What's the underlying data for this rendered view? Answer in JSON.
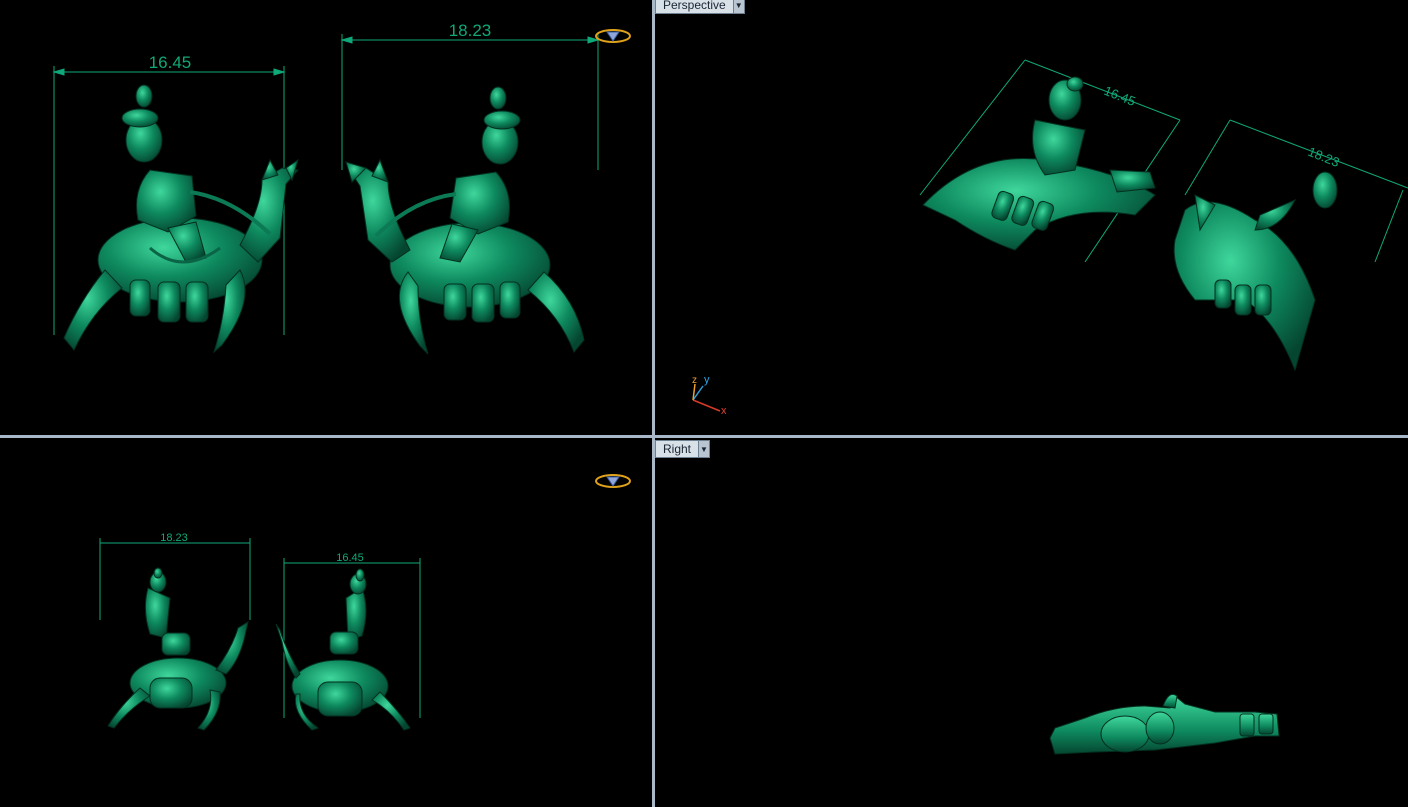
{
  "viewports": {
    "top_left": {
      "label": ""
    },
    "perspective": {
      "label": "Perspective"
    },
    "bottom_left": {
      "label": ""
    },
    "right": {
      "label": "Right"
    }
  },
  "dimensions": {
    "tl_left": "16.45",
    "tl_right": "18.23",
    "persp_left": "16.45",
    "persp_right": "18.23",
    "bl_left": "18.23",
    "bl_right": "16.45"
  },
  "axis": {
    "z": "z",
    "y": "y",
    "x": "x"
  },
  "colors": {
    "model": "#0b7a55",
    "dimension": "#0fa878",
    "background": "#000000",
    "divider": "#a9b8c8",
    "gizmo": "#e0a21a"
  },
  "icons": [
    "diamond-gizmo-icon",
    "dropdown-arrow-icon",
    "axis-triad-icon"
  ]
}
